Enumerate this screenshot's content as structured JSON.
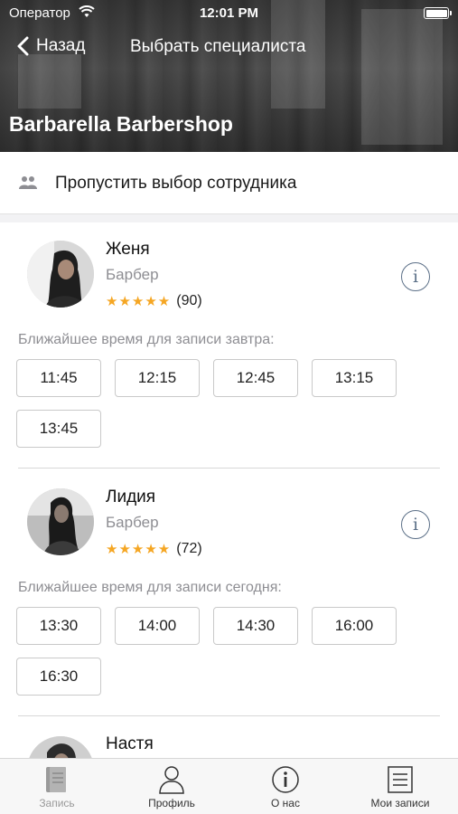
{
  "status_bar": {
    "carrier": "Оператор",
    "time": "12:01 PM"
  },
  "nav": {
    "back_label": "Назад",
    "title": "Выбрать специалиста"
  },
  "venue": {
    "name": "Barbarella Barbershop"
  },
  "skip": {
    "label": "Пропустить выбор сотрудника",
    "icon": "people-icon"
  },
  "specialists": [
    {
      "name": "Женя",
      "role": "Барбер",
      "stars": "★★★★★",
      "rating_value": 5,
      "reviews": "(90)",
      "nearest_label": "Ближайшее время для записи завтра:",
      "slots": [
        "11:45",
        "12:15",
        "12:45",
        "13:15",
        "13:45"
      ]
    },
    {
      "name": "Лидия",
      "role": "Барбер",
      "stars": "★★★★★",
      "rating_value": 5,
      "reviews": "(72)",
      "nearest_label": "Ближайшее время для записи сегодня:",
      "slots": [
        "13:30",
        "14:00",
        "14:30",
        "16:00",
        "16:30"
      ]
    },
    {
      "name": "Настя"
    }
  ],
  "tabs": [
    {
      "label": "Запись",
      "icon": "booking-icon",
      "active": true
    },
    {
      "label": "Профиль",
      "icon": "profile-icon",
      "active": false
    },
    {
      "label": "О нас",
      "icon": "info-icon",
      "active": false
    },
    {
      "label": "Мои записи",
      "icon": "my-bookings-icon",
      "active": false
    }
  ],
  "colors": {
    "star": "#f5a623",
    "info_icon": "#5b6f87",
    "muted_text": "#8e8e93"
  }
}
